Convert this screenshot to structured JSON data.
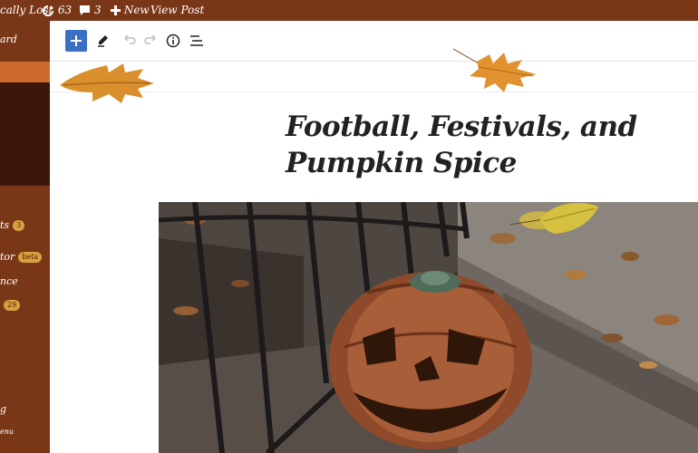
{
  "admin_bar": {
    "site_name": "cally Lost",
    "updates_count": "63",
    "comments_count": "3",
    "new_label": "New",
    "view_post_label": "View Post"
  },
  "sidebar": {
    "items": [
      {
        "label": "ard"
      },
      {
        "label": "ts",
        "badge": "3"
      },
      {
        "label": "tor",
        "badge": "beta"
      },
      {
        "label": "nce"
      },
      {
        "label": "",
        "badge": "29"
      },
      {
        "label": "g"
      },
      {
        "label": "enu"
      }
    ]
  },
  "editor": {
    "post_title": "Football, Festivals, and Pumpkin Spice"
  },
  "colors": {
    "admin_bar_bg": "#7a3717",
    "sidebar_active": "#d06a2c",
    "sidebar_dark": "#3d160a",
    "accent": "#3a6fc4"
  },
  "icons": [
    "refresh-icon",
    "comment-icon",
    "plus-icon",
    "add-block-icon",
    "pencil-icon",
    "undo-icon",
    "redo-icon",
    "info-icon",
    "list-view-icon"
  ]
}
